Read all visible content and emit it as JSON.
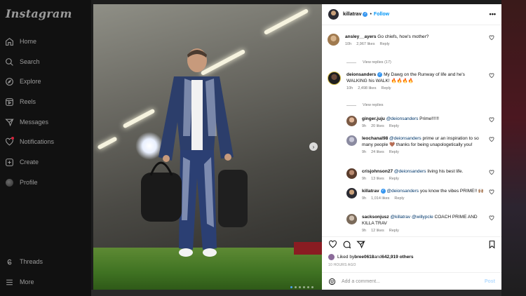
{
  "sidebar": {
    "logo": "Instagram",
    "items": [
      {
        "label": "Home",
        "icon": "home-icon"
      },
      {
        "label": "Search",
        "icon": "search-icon"
      },
      {
        "label": "Explore",
        "icon": "compass-icon"
      },
      {
        "label": "Reels",
        "icon": "reels-icon"
      },
      {
        "label": "Messages",
        "icon": "messenger-icon"
      },
      {
        "label": "Notifications",
        "icon": "heart-icon"
      },
      {
        "label": "Create",
        "icon": "plus-square-icon"
      },
      {
        "label": "Profile",
        "icon": "profile-avatar"
      }
    ],
    "bottom_items": [
      {
        "label": "Threads",
        "icon": "threads-icon"
      },
      {
        "label": "More",
        "icon": "menu-icon"
      }
    ]
  },
  "post": {
    "username": "killatrav",
    "follow_label": "Follow",
    "dot": "•",
    "more": "•••",
    "carousel_count": 6,
    "carousel_active": 0,
    "next_arrow": "›"
  },
  "comments": [
    {
      "user": "ansley__ayers",
      "text": "Go chiefs, how's mother?",
      "time": "10h",
      "likes": "2,967 likes",
      "reply": "Reply",
      "view_replies": "View replies (17)"
    },
    {
      "user": "deionsanders",
      "verified": true,
      "text": "My Dawg on the Runway of life and he's WALKING his WALK! 🔥🔥🔥🔥",
      "time": "10h",
      "likes": "2,498 likes",
      "reply": "Reply",
      "view_replies": "View replies"
    }
  ],
  "replies": [
    {
      "user": "ginger.juju",
      "mention": "@deionsanders",
      "text": " Prime!!!!!!",
      "time": "9h",
      "likes": "20 likes",
      "reply": "Reply"
    },
    {
      "user": "leochanal98",
      "mention": "@deionsanders",
      "text": " prime ur an inspiration to so many people 🤎 thanks for being unapologetically you!",
      "time": "9h",
      "likes": "24 likes",
      "reply": "Reply"
    },
    {
      "user": "crisjohnson27",
      "mention": "@deionsanders",
      "text": " living his best life.",
      "time": "9h",
      "likes": "13 likes",
      "reply": "Reply"
    },
    {
      "user": "killatrav",
      "verified": true,
      "mention": "@deionsanders",
      "text": " you know the vibes PRIME!! 🙌🏽",
      "time": "9h",
      "likes": "1,014 likes",
      "reply": "Reply"
    },
    {
      "user": "sacksonjusz",
      "mention": "@killatrav",
      "mention2": "@willypcle",
      "text": " COACH PRIME AND KILLA TRAV",
      "time": "9h",
      "likes": "12 likes",
      "reply": "Reply"
    }
  ],
  "likes_line": {
    "prefix": "Liked by ",
    "user": "bree0618",
    "middle": " and ",
    "count": "642,919 others"
  },
  "time_ago": "10 HOURS AGO",
  "add_comment": {
    "placeholder": "Add a comment...",
    "post_label": "Post"
  }
}
